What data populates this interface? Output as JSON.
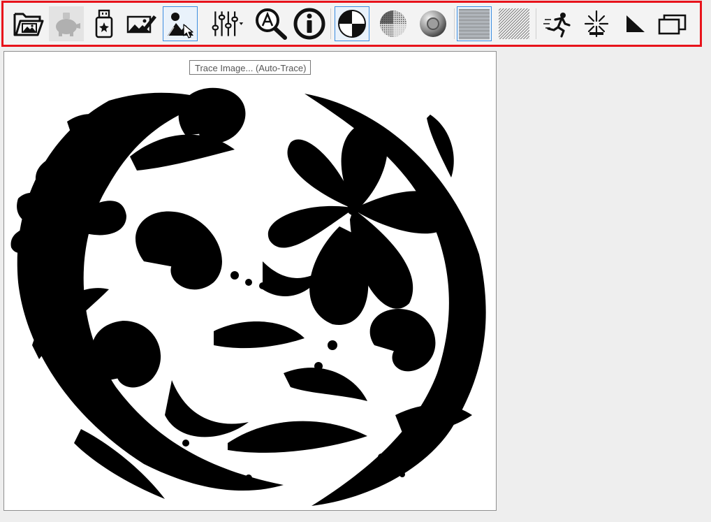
{
  "toolbar": {
    "buttons": [
      {
        "icon": "open-image-folder-icon",
        "state": "normal"
      },
      {
        "icon": "piggy-bank-icon",
        "state": "disabled"
      },
      {
        "icon": "usb-drive-icon",
        "state": "normal"
      },
      {
        "icon": "edit-image-icon",
        "state": "normal"
      },
      {
        "icon": "trace-image-icon",
        "state": "hover"
      },
      {
        "icon": "adjust-sliders-icon",
        "state": "normal"
      },
      {
        "icon": "magnify-text-icon",
        "state": "normal"
      },
      {
        "icon": "info-icon",
        "state": "normal"
      },
      {
        "icon": "threshold-icon",
        "state": "selected"
      },
      {
        "icon": "dither-icon",
        "state": "normal"
      },
      {
        "icon": "grayscale-sphere-icon",
        "state": "normal"
      },
      {
        "icon": "horizontal-raster-icon",
        "state": "selected"
      },
      {
        "icon": "diagonal-raster-icon",
        "state": "normal"
      },
      {
        "icon": "running-person-icon",
        "state": "normal"
      },
      {
        "icon": "laser-burst-icon",
        "state": "normal"
      },
      {
        "icon": "triangle-corner-icon",
        "state": "normal"
      },
      {
        "icon": "window-stack-icon",
        "state": "normal"
      }
    ]
  },
  "tooltip": {
    "text": "Trace Image... (Auto-Trace)"
  },
  "colors": {
    "highlight_border": "#e8131b",
    "selected_border": "#3c8de0",
    "canvas": "#ffffff",
    "background": "#eeeeee"
  },
  "canvas": {
    "image": "black-and-white floral ornament"
  }
}
